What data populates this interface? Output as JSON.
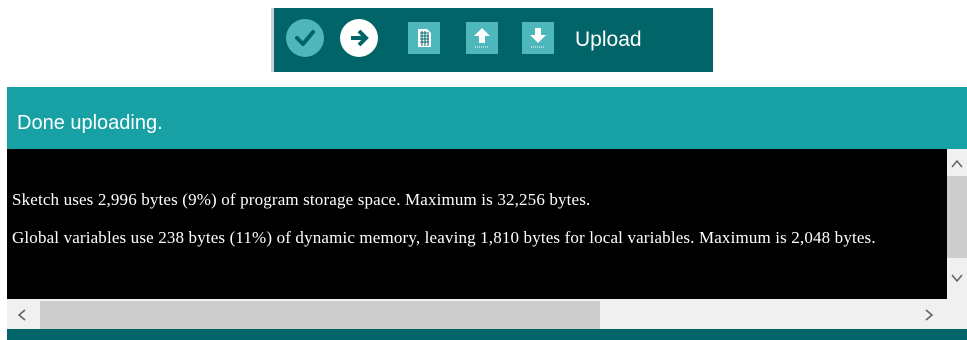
{
  "toolbar": {
    "hover_label": "Upload",
    "buttons": [
      {
        "id": "verify",
        "icon": "checkmark-icon"
      },
      {
        "id": "upload",
        "icon": "arrow-right-icon"
      },
      {
        "id": "new",
        "icon": "document-icon"
      },
      {
        "id": "open",
        "icon": "arrow-up-icon"
      },
      {
        "id": "save",
        "icon": "arrow-down-icon"
      }
    ]
  },
  "status": {
    "message": "Done uploading."
  },
  "console": {
    "lines": [
      "Sketch uses 2,996 bytes (9%) of program storage space. Maximum is 32,256 bytes.",
      "Global variables use 238 bytes (11%) of dynamic memory, leaving 1,810 bytes for local variables. Maximum is 2,048 bytes."
    ]
  },
  "colors": {
    "toolbar_bg": "#006468",
    "button_bg": "#4db7bb",
    "status_bg": "#17a1a5",
    "console_bg": "#000000",
    "console_text": "#ffffff"
  }
}
